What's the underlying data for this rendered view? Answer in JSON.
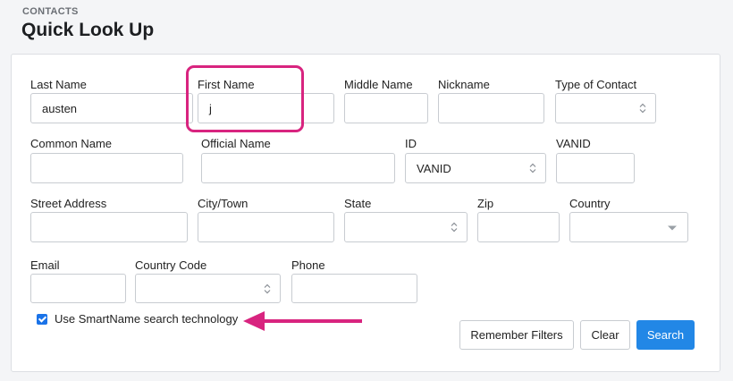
{
  "header": {
    "section": "CONTACTS",
    "title": "Quick Look Up"
  },
  "form": {
    "last_name": {
      "label": "Last Name",
      "value": "austen"
    },
    "first_name": {
      "label": "First Name",
      "value": "j"
    },
    "middle_name": {
      "label": "Middle Name",
      "value": ""
    },
    "nickname": {
      "label": "Nickname",
      "value": ""
    },
    "type_of_contact": {
      "label": "Type of Contact",
      "value": ""
    },
    "common_name": {
      "label": "Common Name",
      "value": ""
    },
    "official_name": {
      "label": "Official Name",
      "value": ""
    },
    "id": {
      "label": "ID",
      "value": "VANID"
    },
    "vanid": {
      "label": "VANID",
      "value": ""
    },
    "street_address": {
      "label": "Street Address",
      "value": ""
    },
    "city_town": {
      "label": "City/Town",
      "value": ""
    },
    "state": {
      "label": "State",
      "value": ""
    },
    "zip": {
      "label": "Zip",
      "value": ""
    },
    "country": {
      "label": "Country",
      "value": ""
    },
    "email": {
      "label": "Email",
      "value": ""
    },
    "country_code": {
      "label": "Country Code",
      "value": ""
    },
    "phone": {
      "label": "Phone",
      "value": ""
    },
    "smartname": {
      "label": "Use SmartName search technology",
      "checked": true
    }
  },
  "buttons": {
    "remember_filters": "Remember Filters",
    "clear": "Clear",
    "search": "Search"
  },
  "colors": {
    "accent": "#2287e6",
    "annotation": "#d8247f"
  }
}
